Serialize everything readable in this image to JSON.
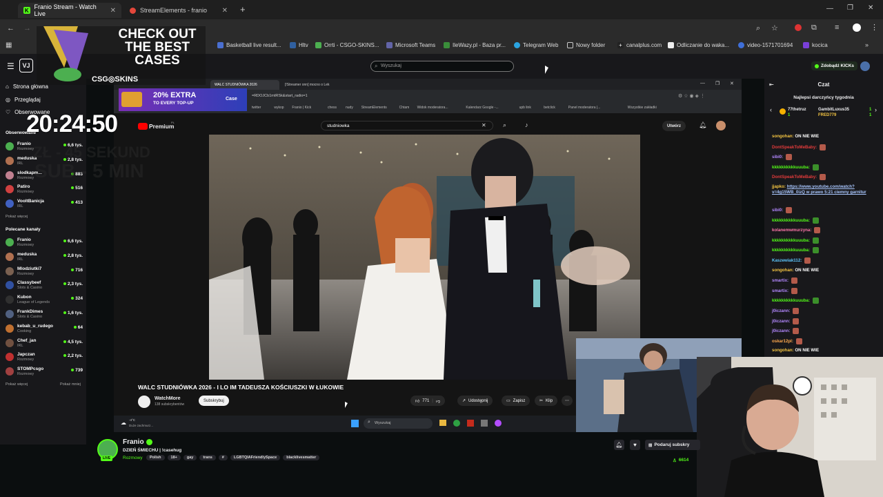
{
  "browser": {
    "tabs": [
      {
        "label": "Franio Stream - Watch Live"
      },
      {
        "label": "StreamElements - franio"
      }
    ],
    "bookmarks": [
      {
        "label": "Basketball live result..."
      },
      {
        "label": "Hltv"
      },
      {
        "label": "Orrti - CSGO-SKINS..."
      },
      {
        "label": "Microsoft Teams"
      },
      {
        "label": "IleWazy.pl - Baza pr..."
      },
      {
        "label": "Telegram Web"
      },
      {
        "label": "Nowy folder"
      },
      {
        "label": "canalplus.com"
      },
      {
        "label": "Odliczanie do waka..."
      },
      {
        "label": "video-1571701694"
      },
      {
        "label": "kocica"
      }
    ]
  },
  "kick": {
    "search_placeholder": "Wyszukaj",
    "get_kicks": "Zdobądź KICKs",
    "nav": [
      {
        "label": "Strona główna"
      },
      {
        "label": "Przeglądaj"
      },
      {
        "label": "Obserwowane"
      }
    ],
    "followed_header": "Obserwowane",
    "followed": [
      {
        "name": "Franio",
        "cat": "Rozmowy",
        "viewers": "6,6 tys.",
        "color": "#4caf50"
      },
      {
        "name": "meduska",
        "cat": "IRL",
        "viewers": "2,8 tys.",
        "color": "#b07050"
      },
      {
        "name": "slodkapm...",
        "cat": "Rozmowy",
        "viewers": "883",
        "color": "#c08090"
      },
      {
        "name": "Patiro",
        "cat": "Rozmowy",
        "viewers": "516",
        "color": "#d04040"
      },
      {
        "name": "VooltBanicja",
        "cat": "IRL",
        "viewers": "413",
        "color": "#4060c0"
      }
    ],
    "show_more_1": "Pokaż więcej",
    "recommended_header": "Polecane kanały",
    "recommended": [
      {
        "name": "Franio",
        "cat": "Rozmowy",
        "viewers": "6,6 tys.",
        "color": "#4caf50"
      },
      {
        "name": "meduska",
        "cat": "IRL",
        "viewers": "2,8 tys.",
        "color": "#b07050"
      },
      {
        "name": "Mlodziutki7",
        "cat": "Rozmowy",
        "viewers": "716",
        "color": "#7a6050"
      },
      {
        "name": "Classybeef",
        "cat": "Slots & Casino",
        "viewers": "2,3 tys.",
        "color": "#3050a0"
      },
      {
        "name": "Kubon",
        "cat": "League of Legends",
        "viewers": "324",
        "color": "#303030"
      },
      {
        "name": "FrankDimes",
        "cat": "Slots & Casino",
        "viewers": "1,6 tys.",
        "color": "#506080"
      },
      {
        "name": "kebab_u_rudego",
        "cat": "Cooking",
        "viewers": "64",
        "color": "#c07030"
      },
      {
        "name": "Chef_jan",
        "cat": "IRL",
        "viewers": "4,5 tys.",
        "color": "#705040"
      },
      {
        "name": "Japczan",
        "cat": "Rozmowy",
        "viewers": "2,2 tys.",
        "color": "#c03030"
      },
      {
        "name": "STOMPcsgo",
        "cat": "Rozmowy",
        "viewers": "739",
        "color": "#a04040"
      }
    ],
    "show_more_2": "Pokaż więcej",
    "show_less": "Pokaż mniej"
  },
  "overlay": {
    "ad_line1": "CHECK OUT",
    "ad_line2": "THE BEST",
    "ad_line3": "CASES",
    "ad_brand": "CSG◎SKINS",
    "ad2_line1": "20% EXTRA",
    "ad2_line2": "TO EVERY TOP-UP",
    "ad2_brand": "Case",
    "clock": "20:24:50",
    "ghost1": "ZŁ - 45 SEKUND",
    "ghost2": "SUB - 5 MIN"
  },
  "inner": {
    "tab1": "WALC STUDNIÓWKA 2026",
    "tab2": "[!Streamer onn] mocno o Lek",
    "url": "=RDOJCb1mtRSk&start_radio=1",
    "bookmarks": [
      "twitter",
      "wykop",
      "Franio | Kick",
      "chess",
      "nudy",
      "StreamElements",
      "Chtam",
      "Widok moderatora...",
      "Kalendarz Google -...",
      "upb link",
      "betclick",
      "Panel moderatora |...",
      "Wszystkie zakładki"
    ],
    "yt_logo": "Premium",
    "yt_country": "PL",
    "yt_search": "studniowka",
    "create": "Utwórz",
    "video_title": "WALC STUDNIÓWKA 2026 - I LO IM TADEUSZA KOŚCIUSZKI W ŁUKOWIE",
    "channel": "WatchMore",
    "subs": "138 subskrybentów",
    "subscribe": "Subskrybuj",
    "likes": "771",
    "share": "Udostępnij",
    "save": "Zapisz",
    "clip": "Klip",
    "weather_temp": "-4°C",
    "weather_desc": "Duże zachmurz...",
    "taskbar_search": "Wyszukaj"
  },
  "chat": {
    "title": "Czat",
    "top_title": "Najlepsi darczyńcy tygodnia",
    "top": [
      {
        "name": "77thetruz",
        "count": "1"
      },
      {
        "name": "GambitLuxus35",
        "count": "1"
      },
      {
        "name": "FRED779",
        "count": "1"
      }
    ],
    "messages": [
      {
        "user": "songohan:",
        "text": "ON NIE WIE",
        "color": "#f5c542"
      },
      {
        "user": "DontSpeakToMeBaby:",
        "text": "",
        "color": "#e33b3b"
      },
      {
        "user": "sibi0:",
        "text": "",
        "color": "#b388ff"
      },
      {
        "user": "kkkkkkkkkkuuuba:",
        "text": "",
        "color": "#53fc18"
      },
      {
        "user": "DontSpeakToMeBaby:",
        "text": "",
        "color": "#e33b3b"
      },
      {
        "user": "jjapko:",
        "text": "https://www.youtube.com/watch?v=4g15WB_0izQ w prawo 5:21 ciemny garnitur",
        "color": "#f5c542"
      },
      {
        "user": "sibi0:",
        "text": "",
        "color": "#b388ff"
      },
      {
        "user": "kkkkkkkkkkuuuba:",
        "text": "",
        "color": "#53fc18"
      },
      {
        "user": "kolanemwmurzyna:",
        "text": "",
        "color": "#ff77aa"
      },
      {
        "user": "kkkkkkkkkkuuuba:",
        "text": "",
        "color": "#53fc18"
      },
      {
        "user": "kkkkkkkkkkuuuba:",
        "text": "",
        "color": "#53fc18"
      },
      {
        "user": "Kaszewiak112:",
        "text": "",
        "color": "#5ec8ff"
      },
      {
        "user": "songohan:",
        "text": "ON NIE WIE",
        "color": "#f5c542"
      },
      {
        "user": "smartix:",
        "text": "",
        "color": "#b388ff"
      },
      {
        "user": "smartix:",
        "text": "",
        "color": "#b388ff"
      },
      {
        "user": "kkkkkkkkkkuuuba:",
        "text": "",
        "color": "#53fc18"
      },
      {
        "user": "j0iczann:",
        "text": "",
        "color": "#b388ff"
      },
      {
        "user": "j0iczann:",
        "text": "",
        "color": "#b388ff"
      },
      {
        "user": "j0iczann:",
        "text": "",
        "color": "#b388ff"
      },
      {
        "user": "oskar12pl:",
        "text": "",
        "color": "#ffa94d"
      },
      {
        "user": "songohan:",
        "text": "ON NIE WIE",
        "color": "#f5c542"
      }
    ]
  },
  "streamer": {
    "name": "Franio",
    "title": "DZIEŃ ŚMIECHU | !casehug",
    "category": "Rozmowy",
    "tags": [
      "Polish",
      "18+",
      "gay",
      "trans",
      "#",
      "LGBTQIAFriendlySpace",
      "blacklivesmatter"
    ],
    "subscribe": "Podaruj subskry",
    "viewers": "6614"
  },
  "colors": {
    "kick_green": "#53fc18",
    "bg": "#0b0e0f",
    "panel": "#18181b"
  }
}
